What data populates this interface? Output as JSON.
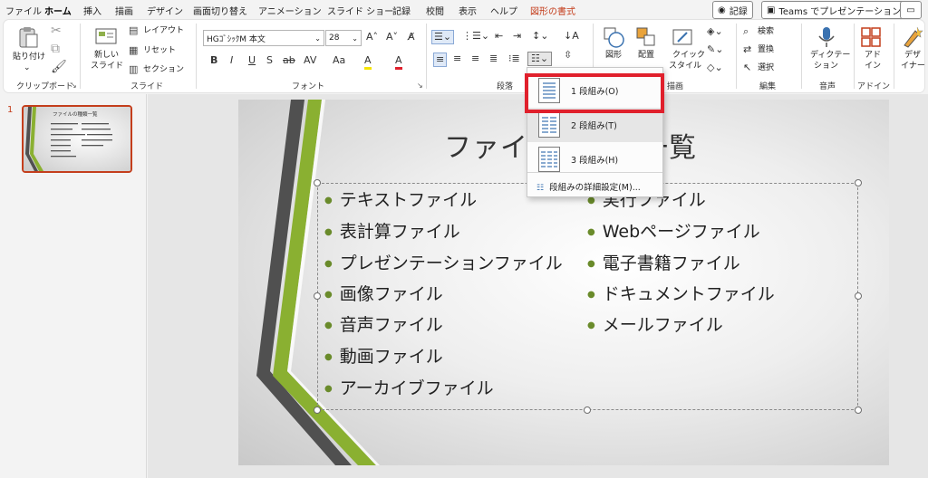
{
  "menu": {
    "tabs": [
      "ファイル",
      "ホーム",
      "挿入",
      "描画",
      "デザイン",
      "画面切り替え",
      "アニメーション",
      "スライド ショー",
      "記録",
      "校閲",
      "表示",
      "ヘルプ",
      "図形の書式"
    ],
    "record_label": "記録",
    "teams_label": "Teams でプレゼンテーション"
  },
  "ribbon": {
    "clipboard": {
      "paste_label": "貼り付け",
      "group_label": "クリップボード"
    },
    "slides": {
      "new_slide_label": "新しい\nスライド",
      "new_slide_l1": "新しい",
      "new_slide_l2": "スライド",
      "layout_label": "レイアウト",
      "reset_label": "リセット",
      "section_label": "セクション",
      "group_label": "スライド"
    },
    "font": {
      "font_name": "HGｺﾞｼｯｸM 本文",
      "font_size": "28",
      "group_label": "フォント",
      "buttons": [
        "B",
        "I",
        "U",
        "S",
        "ab",
        "AV",
        "Aa",
        "A",
        "A"
      ]
    },
    "paragraph": {
      "group_label": "段落"
    },
    "drawing": {
      "shape_label": "図形",
      "arrange_label": "配置",
      "quick_style_l1": "クイック",
      "quick_style_l2": "スタイル",
      "group_label": "描画"
    },
    "editing": {
      "find_label": "検索",
      "replace_label": "置換",
      "select_label": "選択",
      "group_label": "編集"
    },
    "voice": {
      "dictate_l1": "ディクテー",
      "dictate_l2": "ション",
      "group_label": "音声"
    },
    "addins": {
      "addin_l1": "アド",
      "addin_l2": "イン",
      "group_label": "アドイン"
    },
    "designer": {
      "l1": "デザ",
      "l2": "イナー"
    }
  },
  "thumbnail": {
    "number": "1",
    "title": "ファイルの種類一覧"
  },
  "slide": {
    "title": "ファイルの種類一覧",
    "left_items": [
      "テキストファイル",
      "表計算ファイル",
      "プレゼンテーションファイル",
      "画像ファイル",
      "音声ファイル",
      "動画ファイル",
      "アーカイブファイル"
    ],
    "right_items": [
      "実行ファイル",
      "Webページファイル",
      "電子書籍ファイル",
      "ドキュメントファイル",
      "メールファイル"
    ]
  },
  "columns_menu": {
    "items": [
      "1 段組み(O)",
      "2 段組み(T)",
      "3 段組み(H)"
    ],
    "more": "段組みの詳細設定(M)..."
  },
  "colors": {
    "accent": "#c43e1c",
    "highlight": "#e0202c",
    "bullet": "#6a8b2b"
  }
}
